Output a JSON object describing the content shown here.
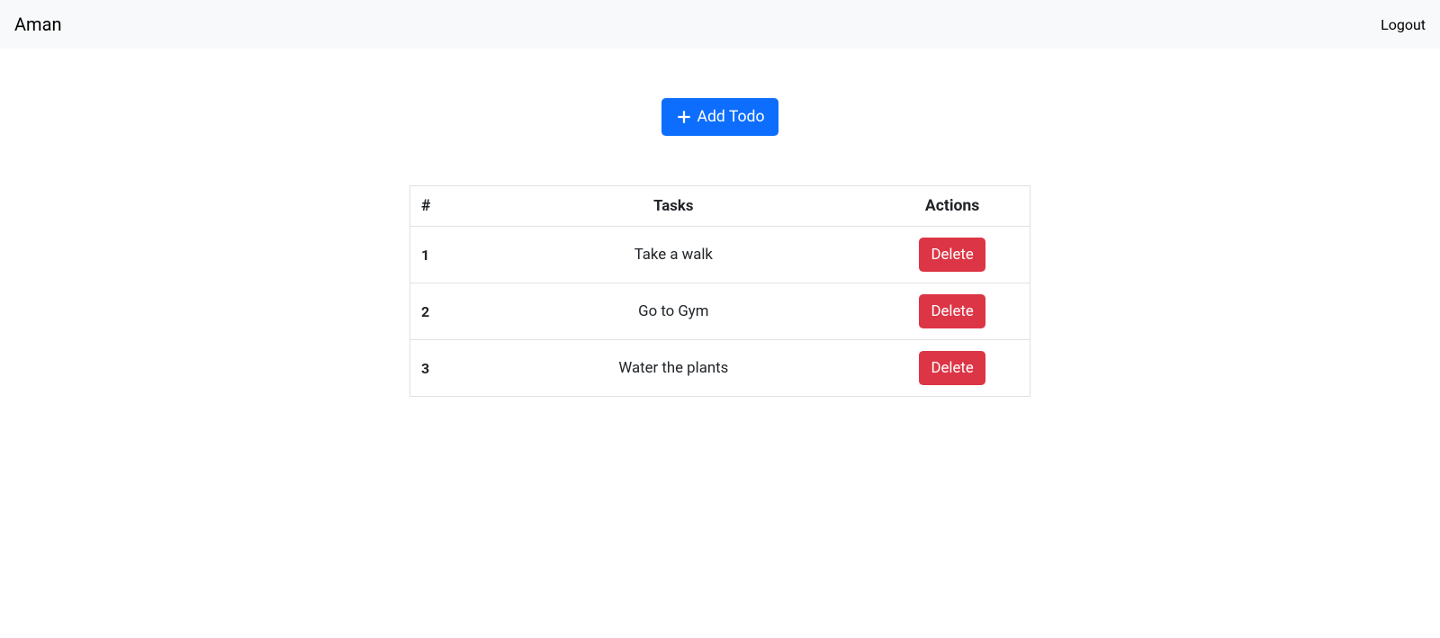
{
  "navbar": {
    "brand": "Aman",
    "logout_label": "Logout"
  },
  "actions": {
    "add_todo_label": "Add Todo",
    "delete_label": "Delete"
  },
  "table": {
    "headers": {
      "number": "#",
      "tasks": "Tasks",
      "actions": "Actions"
    },
    "rows": [
      {
        "num": "1",
        "task": "Take a walk"
      },
      {
        "num": "2",
        "task": "Go to Gym"
      },
      {
        "num": "3",
        "task": "Water the plants"
      }
    ]
  }
}
